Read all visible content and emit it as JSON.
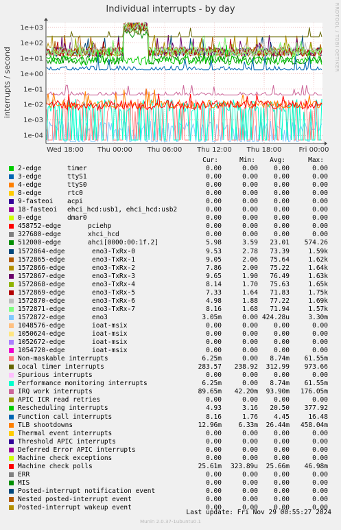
{
  "title": "Individual interrupts - by day",
  "side_credit": "RRDTOOL / TOBI OETIKER",
  "ylabel": "interrupts / second",
  "columns": {
    "cur": "Cur:",
    "min": "Min:",
    "avg": "Avg:",
    "max": "Max:"
  },
  "last_update": "Last update: Fri Nov 29 00:55:27 2024",
  "footer": "Munin 2.0.37-1ubuntu0.1",
  "chart_data": {
    "type": "line",
    "title": "Individual interrupts - by day",
    "ylabel": "interrupts / second",
    "yscale": "log",
    "ylim": [
      3e-05,
      2000
    ],
    "yticks": [
      "1e+03",
      "1e+02",
      "1e+01",
      "1e+00",
      "1e-01",
      "1e-02",
      "1e-03",
      "1e-04"
    ],
    "xticks": [
      "Wed 18:00",
      "Thu 00:00",
      "Thu 06:00",
      "Thu 12:00",
      "Thu 18:00",
      "Fri 00:00"
    ],
    "grid": true,
    "series": [
      {
        "name": "2-edge",
        "dev": "timer",
        "color": "#00cc00",
        "cur": "0.00",
        "min": "0.00",
        "avg": "0.00",
        "max": "0.00"
      },
      {
        "name": "3-edge",
        "dev": "ttyS1",
        "color": "#0066b3",
        "cur": "0.00",
        "min": "0.00",
        "avg": "0.00",
        "max": "0.00"
      },
      {
        "name": "4-edge",
        "dev": "ttyS0",
        "color": "#ff8000",
        "cur": "0.00",
        "min": "0.00",
        "avg": "0.00",
        "max": "0.00"
      },
      {
        "name": "8-edge",
        "dev": "rtc0",
        "color": "#ffcc00",
        "cur": "0.00",
        "min": "0.00",
        "avg": "0.00",
        "max": "0.00"
      },
      {
        "name": "9-fasteoi",
        "dev": "acpi",
        "color": "#330099",
        "cur": "0.00",
        "min": "0.00",
        "avg": "0.00",
        "max": "0.00"
      },
      {
        "name": "18-fasteoi",
        "dev": "ehci_hcd:usb1, ehci_hcd:usb2",
        "color": "#990099",
        "cur": "0.00",
        "min": "0.00",
        "avg": "0.00",
        "max": "0.00"
      },
      {
        "name": "0-edge",
        "dev": "dmar0",
        "color": "#ccff00",
        "cur": "0.00",
        "min": "0.00",
        "avg": "0.00",
        "max": "0.00"
      },
      {
        "name": "458752-edge",
        "dev": "pciehp",
        "color": "#ff0000",
        "cur": "0.00",
        "min": "0.00",
        "avg": "0.00",
        "max": "0.00"
      },
      {
        "name": "327680-edge",
        "dev": "xhci_hcd",
        "color": "#808080",
        "cur": "0.00",
        "min": "0.00",
        "avg": "0.00",
        "max": "0.00"
      },
      {
        "name": "512000-edge",
        "dev": "ahci[0000:00:1f.2]",
        "color": "#008f00",
        "cur": "5.98",
        "min": "3.59",
        "avg": "23.01",
        "max": "574.26"
      },
      {
        "name": "1572864-edge",
        "dev": "eno3-TxRx-0",
        "color": "#00487d",
        "cur": "9.53",
        "min": "2.78",
        "avg": "73.39",
        "max": "1.59k"
      },
      {
        "name": "1572865-edge",
        "dev": "eno3-TxRx-1",
        "color": "#b35a00",
        "cur": "9.05",
        "min": "2.06",
        "avg": "75.64",
        "max": "1.62k"
      },
      {
        "name": "1572866-edge",
        "dev": "eno3-TxRx-2",
        "color": "#b38f00",
        "cur": "7.86",
        "min": "2.00",
        "avg": "75.22",
        "max": "1.64k"
      },
      {
        "name": "1572867-edge",
        "dev": "eno3-TxRx-3",
        "color": "#6b006b",
        "cur": "9.65",
        "min": "1.90",
        "avg": "76.49",
        "max": "1.63k"
      },
      {
        "name": "1572868-edge",
        "dev": "eno3-TxRx-4",
        "color": "#8fb300",
        "cur": "8.14",
        "min": "1.70",
        "avg": "75.63",
        "max": "1.65k"
      },
      {
        "name": "1572869-edge",
        "dev": "eno3-TxRx-5",
        "color": "#b30000",
        "cur": "7.33",
        "min": "1.64",
        "avg": "71.83",
        "max": "1.75k"
      },
      {
        "name": "1572870-edge",
        "dev": "eno3-TxRx-6",
        "color": "#bebebe",
        "cur": "4.98",
        "min": "1.88",
        "avg": "77.22",
        "max": "1.69k"
      },
      {
        "name": "1572871-edge",
        "dev": "eno3-TxRx-7",
        "color": "#80ff80",
        "cur": "8.16",
        "min": "1.68",
        "avg": "71.94",
        "max": "1.57k"
      },
      {
        "name": "1572872-edge",
        "dev": "eno3",
        "color": "#80c9ff",
        "cur": "3.05m",
        "min": "0.00",
        "avg": "424.28u",
        "max": "3.30m"
      },
      {
        "name": "1048576-edge",
        "dev": "ioat-msix",
        "color": "#ffc080",
        "cur": "0.00",
        "min": "0.00",
        "avg": "0.00",
        "max": "0.00"
      },
      {
        "name": "1050624-edge",
        "dev": "ioat-msix",
        "color": "#ffe680",
        "cur": "0.00",
        "min": "0.00",
        "avg": "0.00",
        "max": "0.00"
      },
      {
        "name": "1052672-edge",
        "dev": "ioat-msix",
        "color": "#aa80ff",
        "cur": "0.00",
        "min": "0.00",
        "avg": "0.00",
        "max": "0.00"
      },
      {
        "name": "1054720-edge",
        "dev": "ioat-msix",
        "color": "#ee00cc",
        "cur": "0.00",
        "min": "0.00",
        "avg": "0.00",
        "max": "0.00"
      },
      {
        "name": "Non-maskable interrupts",
        "dev": "",
        "color": "#ff8080",
        "cur": "6.25m",
        "min": "0.00",
        "avg": "8.74m",
        "max": "61.55m"
      },
      {
        "name": "Local timer interrupts",
        "dev": "",
        "color": "#666600",
        "cur": "283.57",
        "min": "238.92",
        "avg": "312.99",
        "max": "973.66"
      },
      {
        "name": "Spurious interrupts",
        "dev": "",
        "color": "#ffbfff",
        "cur": "0.00",
        "min": "0.00",
        "avg": "0.00",
        "max": "0.00"
      },
      {
        "name": "Performance monitoring interrupts",
        "dev": "",
        "color": "#00ffcc",
        "cur": "6.25m",
        "min": "0.00",
        "avg": "8.74m",
        "max": "61.55m"
      },
      {
        "name": "IRQ work interrupts",
        "dev": "",
        "color": "#cc6699",
        "cur": "89.65m",
        "min": "42.20m",
        "avg": "93.90m",
        "max": "176.05m"
      },
      {
        "name": "APIC ICR read retries",
        "dev": "",
        "color": "#999900",
        "cur": "0.00",
        "min": "0.00",
        "avg": "0.00",
        "max": "0.00"
      },
      {
        "name": "Rescheduling interrupts",
        "dev": "",
        "color": "#00cc00",
        "cur": "4.93",
        "min": "3.16",
        "avg": "20.50",
        "max": "377.92"
      },
      {
        "name": "Function call interrupts",
        "dev": "",
        "color": "#0066b3",
        "cur": "8.16",
        "min": "1.76",
        "avg": "4.45",
        "max": "16.48"
      },
      {
        "name": "TLB shootdowns",
        "dev": "",
        "color": "#ff8000",
        "cur": "12.96m",
        "min": "6.33m",
        "avg": "26.44m",
        "max": "458.04m"
      },
      {
        "name": "Thermal event interrupts",
        "dev": "",
        "color": "#ffcc00",
        "cur": "0.00",
        "min": "0.00",
        "avg": "0.00",
        "max": "0.00"
      },
      {
        "name": "Threshold APIC interrupts",
        "dev": "",
        "color": "#330099",
        "cur": "0.00",
        "min": "0.00",
        "avg": "0.00",
        "max": "0.00"
      },
      {
        "name": "Deferred Error APIC interrupts",
        "dev": "",
        "color": "#990099",
        "cur": "0.00",
        "min": "0.00",
        "avg": "0.00",
        "max": "0.00"
      },
      {
        "name": "Machine check exceptions",
        "dev": "",
        "color": "#ccff00",
        "cur": "0.00",
        "min": "0.00",
        "avg": "0.00",
        "max": "0.00"
      },
      {
        "name": "Machine check polls",
        "dev": "",
        "color": "#ff0000",
        "cur": "25.61m",
        "min": "323.89u",
        "avg": "25.66m",
        "max": "46.98m"
      },
      {
        "name": "ERR",
        "dev": "",
        "color": "#808080",
        "cur": "0.00",
        "min": "0.00",
        "avg": "0.00",
        "max": "0.00"
      },
      {
        "name": "MIS",
        "dev": "",
        "color": "#008f00",
        "cur": "0.00",
        "min": "0.00",
        "avg": "0.00",
        "max": "0.00"
      },
      {
        "name": "Posted-interrupt notification event",
        "dev": "",
        "color": "#00487d",
        "cur": "0.00",
        "min": "0.00",
        "avg": "0.00",
        "max": "0.00"
      },
      {
        "name": "Nested posted-interrupt event",
        "dev": "",
        "color": "#b35a00",
        "cur": "0.00",
        "min": "0.00",
        "avg": "0.00",
        "max": "0.00"
      },
      {
        "name": "Posted-interrupt wakeup event",
        "dev": "",
        "color": "#b38f00",
        "cur": "0.00",
        "min": "0.00",
        "avg": "0.00",
        "max": "0.00"
      }
    ]
  }
}
